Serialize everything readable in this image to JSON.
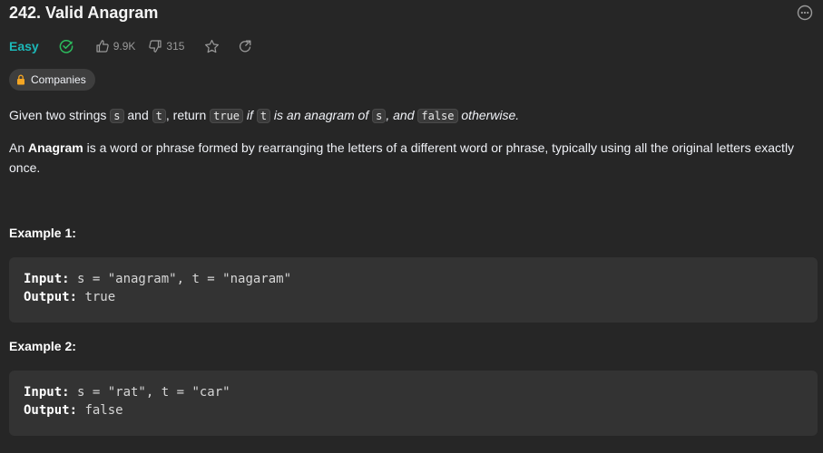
{
  "problem": {
    "title": "242. Valid Anagram",
    "difficulty": "Easy",
    "likes": "9.9K",
    "dislikes": "315",
    "companies_label": "Companies",
    "accent_easy": "#1cb8b8",
    "accent_solved": "#2cbb5d"
  },
  "description": {
    "p1": {
      "t1": "Given two strings ",
      "c1": "s",
      "t2": " and ",
      "c2": "t",
      "t3": ", return ",
      "c3": "true",
      "e1": " if ",
      "c4": "t",
      "e2": " is an anagram of ",
      "c5": "s",
      "e3": ", and ",
      "c6": "false",
      "e4": " otherwise."
    },
    "p2": {
      "t1": "An ",
      "b1": "Anagram",
      "t2": " is a word or phrase formed by rearranging the letters of a different word or phrase, typically using all the original letters exactly once."
    }
  },
  "examples": [
    {
      "title": "Example 1:",
      "input_label": "Input:",
      "input_value": " s = \"anagram\", t = \"nagaram\"",
      "output_label": "Output:",
      "output_value": " true"
    },
    {
      "title": "Example 2:",
      "input_label": "Input:",
      "input_value": " s = \"rat\", t = \"car\"",
      "output_label": "Output:",
      "output_value": " false"
    }
  ],
  "icons": {
    "more": "more-horizontal-circle-icon",
    "solved": "check-circle-icon",
    "like": "thumbs-up-icon",
    "dislike": "thumbs-down-icon",
    "star": "star-icon",
    "share": "share-icon",
    "lock": "lock-icon"
  }
}
